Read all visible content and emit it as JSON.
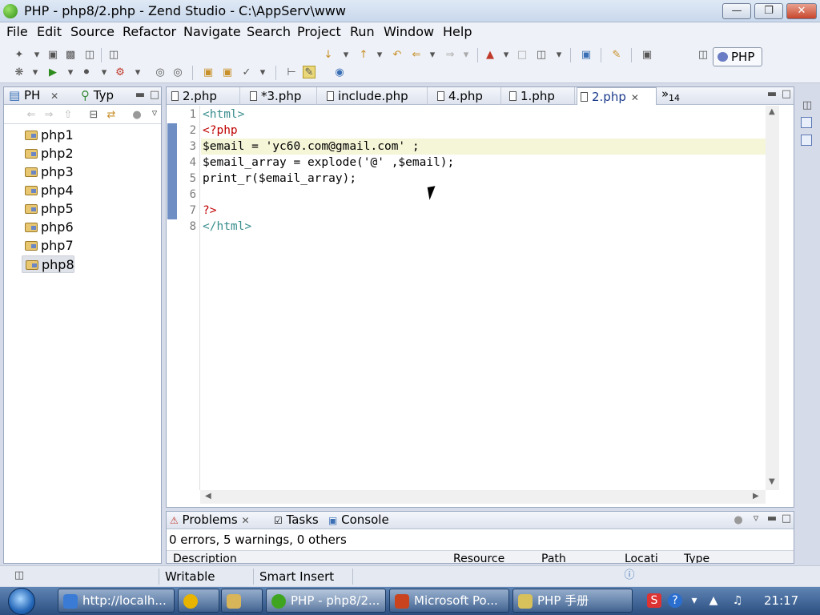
{
  "window": {
    "title": "PHP - php8/2.php - Zend Studio - C:\\AppServ\\www",
    "min_glyph": "—",
    "max_glyph": "❐",
    "close_glyph": "✕"
  },
  "menu": [
    "File",
    "Edit",
    "Source",
    "Refactor",
    "Navigate",
    "Search",
    "Project",
    "Run",
    "Window",
    "Help"
  ],
  "perspective": {
    "label": "PHP"
  },
  "left_panel": {
    "tabs": [
      {
        "label": "PH",
        "close": "✕"
      },
      {
        "label": "Typ"
      }
    ],
    "projects": [
      "php1",
      "php2",
      "php3",
      "php4",
      "php5",
      "php6",
      "php7",
      "php8"
    ],
    "selected": "php8"
  },
  "editor": {
    "tabs": [
      {
        "label": "2.php"
      },
      {
        "label": "*3.php"
      },
      {
        "label": "include.php"
      },
      {
        "label": "4.php"
      },
      {
        "label": "1.php"
      },
      {
        "label": "2.php",
        "active": true,
        "close": "✕"
      }
    ],
    "overflow": {
      "chevron": "»",
      "count": "14"
    },
    "lines": [
      {
        "num": "1",
        "text": "<html>"
      },
      {
        "num": "2",
        "text": "<?php"
      },
      {
        "num": "3",
        "text": "$email = 'yc60.com@gmail.com' ;"
      },
      {
        "num": "4",
        "text": "$email_array = explode('@' ,$email);"
      },
      {
        "num": "5",
        "text": "print_r($email_array);"
      },
      {
        "num": "6",
        "text": ""
      },
      {
        "num": "7",
        "text": "?>"
      },
      {
        "num": "8",
        "text": "</html>"
      }
    ]
  },
  "problems": {
    "tabs": [
      {
        "label": "Problems",
        "close": "✕"
      },
      {
        "label": "Tasks"
      },
      {
        "label": "Console"
      }
    ],
    "summary": "0 errors, 5 warnings, 0 others",
    "columns": [
      "Description",
      "Resource",
      "Path",
      "Locati",
      "Type"
    ]
  },
  "status": {
    "mode": "Writable",
    "insert": "Smart Insert"
  },
  "taskbar": {
    "tasks": [
      {
        "label": "http://localh...",
        "color": "#3a7bd5"
      },
      {
        "label": "",
        "color": "#e8b400"
      },
      {
        "label": "",
        "color": "#d9b55a"
      },
      {
        "label": "PHP - php8/2...",
        "color": "#3fa520",
        "active": true
      },
      {
        "label": "Microsoft Po...",
        "color": "#c9431f"
      },
      {
        "label": "PHP 手册",
        "color": "#d8c05a"
      }
    ],
    "clock": "21:17"
  }
}
